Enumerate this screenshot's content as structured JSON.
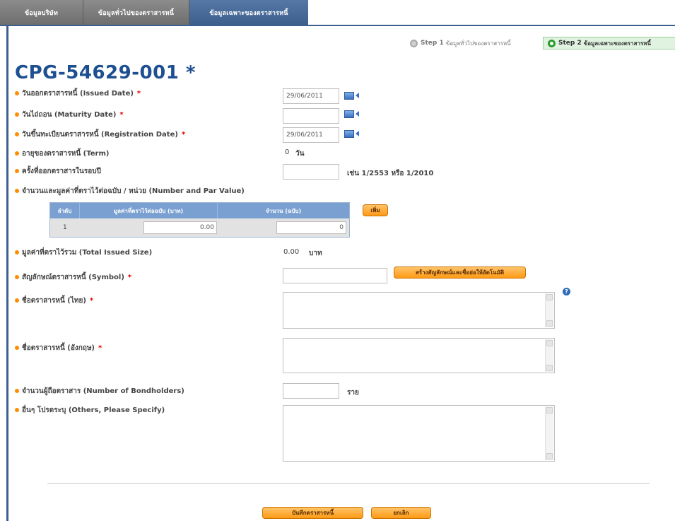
{
  "tabs": [
    {
      "label": "ข้อมูลบริษัท"
    },
    {
      "label": "ข้อมูลทั่วไปของตราสารหนี้"
    },
    {
      "label": "ข้อมูลเฉพาะของตราสารหนี้"
    }
  ],
  "steps": {
    "step1": {
      "num": "Step 1",
      "label": "ข้อมูลทั่วไปของตราสารหนี้"
    },
    "step2": {
      "num": "Step 2",
      "label": "ข้อมูลเฉพาะของตราสารหนี้"
    }
  },
  "page_title": "CPG-54629-001 *",
  "fields": {
    "issued_date": {
      "label": "วันออกตราสารหนี้ (Issued Date)",
      "required": "*",
      "value": "29/06/2011"
    },
    "maturity_date": {
      "label": "วันไถ่ถอน (Maturity Date)",
      "required": "*",
      "value": ""
    },
    "registration_date": {
      "label": "วันขึ้นทะเบียนตราสารหนี้ (Registration Date)",
      "required": "*",
      "value": "29/06/2011"
    },
    "term": {
      "label": "อายุของตราสารหนี้ (Term)",
      "value": "0",
      "unit": "วัน"
    },
    "issue_no": {
      "label": "ครั้งที่ออกตราสารในรอบปี",
      "value": "",
      "hint": "เช่น 1/2553 หรือ 1/2010"
    },
    "number_par": {
      "label": "จำนวนและมูลค่าที่ตราไว้ต่อฉบับ / หน่วย (Number and Par Value)"
    },
    "total_size": {
      "label": "มูลค่าที่ตราไว้รวม (Total Issued Size)",
      "value": "0.00",
      "unit": "บาท"
    },
    "symbol": {
      "label": "สัญลักษณ์ตราสารหนี้ (Symbol)",
      "required": "*",
      "value": "",
      "button": "สร้างสัญลักษณ์และชื่อย่อให้อัตโนมัติ"
    },
    "name_th": {
      "label": "ชื่อตราสารหนี้ (ไทย)",
      "required": "*"
    },
    "name_en": {
      "label": "ชื่อตราสารหนี้ (อังกฤษ)",
      "required": "*"
    },
    "bondholders": {
      "label": "จำนวนผู้ถือตราสาร (Number of Bondholders)",
      "value": "",
      "unit": "ราย"
    },
    "others": {
      "label": "อื่นๆ โปรดระบุ (Others, Please Specify)"
    }
  },
  "par_table": {
    "headers": [
      "ลำดับ",
      "มูลค่าที่ตราไว้ต่อฉบับ (บาท)",
      "จำนวน (ฉบับ)"
    ],
    "rows": [
      {
        "no": "1",
        "par": "0.00",
        "count": "0"
      }
    ],
    "add_button": "เพิ่ม"
  },
  "help_icon": "?",
  "actions": {
    "save": "บันทึกตราสารหนี้",
    "cancel": "ยกเลิก"
  },
  "colors": {
    "accent": "#1d4f91",
    "active_tab": "#3d5f8e",
    "button": "#ff9a14",
    "required": "#e00000"
  }
}
